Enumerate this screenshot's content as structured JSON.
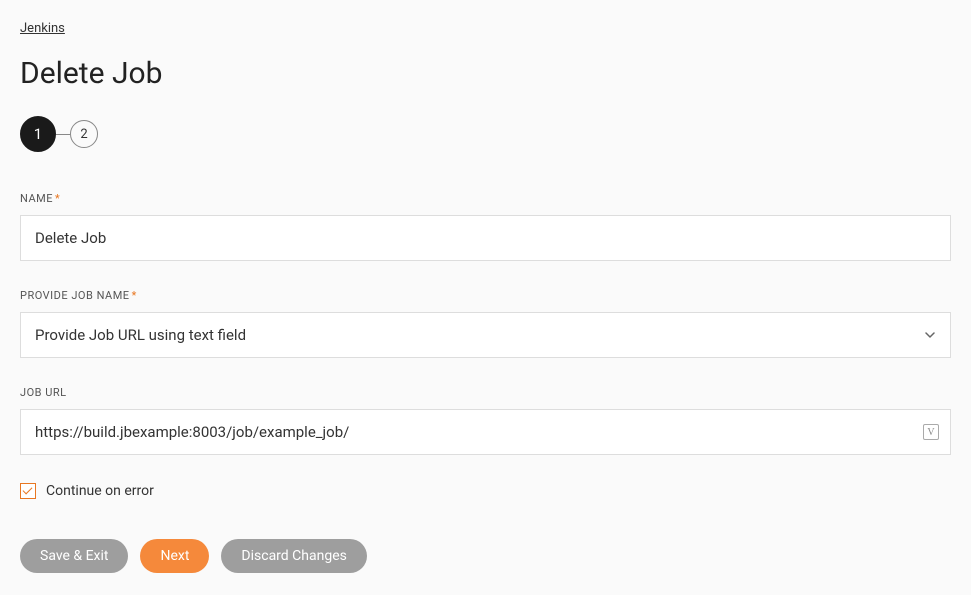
{
  "breadcrumb": "Jenkins",
  "page_title": "Delete Job",
  "stepper": {
    "step1": "1",
    "step2": "2"
  },
  "form": {
    "name_label": "NAME",
    "name_value": "Delete Job",
    "provide_job_label": "PROVIDE JOB NAME",
    "provide_job_value": "Provide Job URL using text field",
    "job_url_label": "JOB URL",
    "job_url_value": "https://build.jbexample:8003/job/example_job/",
    "continue_label": "Continue on error",
    "var_icon_text": "V"
  },
  "buttons": {
    "save_exit": "Save & Exit",
    "next": "Next",
    "discard": "Discard Changes"
  }
}
